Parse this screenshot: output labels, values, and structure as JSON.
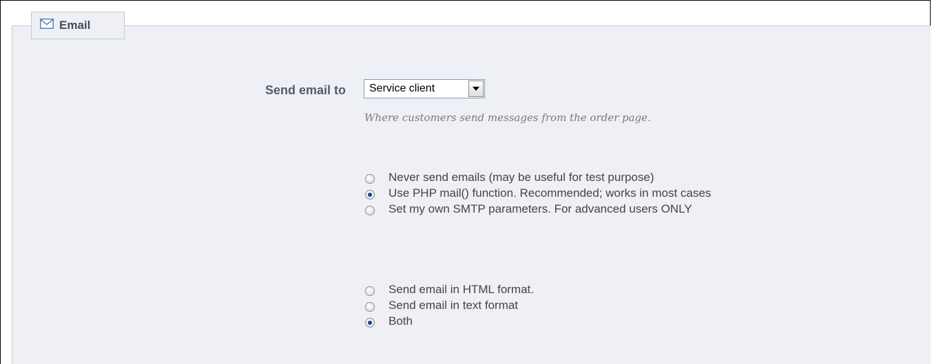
{
  "section": {
    "title": "Email",
    "icon": "envelope-icon"
  },
  "send_email_to": {
    "label": "Send email to",
    "selected": "Service client",
    "hint": "Where customers send messages from the order page."
  },
  "mail_method": {
    "options": [
      {
        "label": "Never send emails (may be useful for test purpose)",
        "checked": false
      },
      {
        "label": "Use PHP mail() function. Recommended; works in most cases",
        "checked": true
      },
      {
        "label": "Set my own SMTP parameters. For advanced users ONLY",
        "checked": false
      }
    ]
  },
  "mail_format": {
    "options": [
      {
        "label": "Send email in HTML format.",
        "checked": false
      },
      {
        "label": "Send email in text format",
        "checked": false
      },
      {
        "label": "Both",
        "checked": true
      }
    ]
  },
  "colors": {
    "panel_bg": "#eef0f5",
    "border": "#c3c8d1",
    "label": "#585a69",
    "radio_dot": "#1f3f8a"
  }
}
